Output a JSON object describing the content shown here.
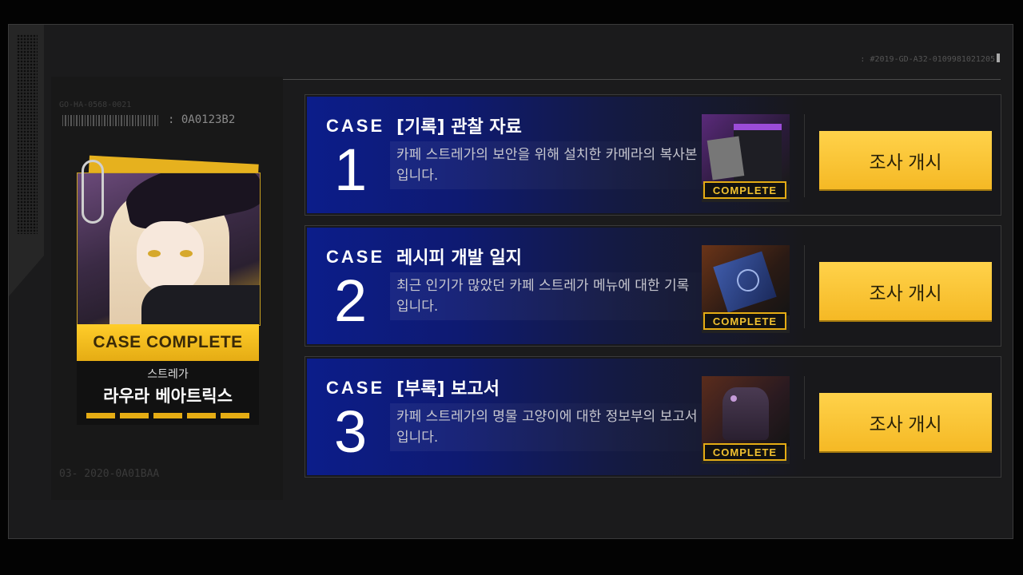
{
  "header": {
    "serial_code": ": #2019-GD-A32-0109981021205"
  },
  "left_panel": {
    "barcode_code": ": 0A0123B2",
    "decor_code_top": "GO-HA-0568-0021",
    "decor_code_bottom": "03- 2020-0A01BAA"
  },
  "character_card": {
    "banner": "CASE COMPLETE",
    "subtitle": "스트레가",
    "name": "라우라 베아트릭스",
    "progress_pips": 5
  },
  "cases": [
    {
      "label": "CASE",
      "number": "1",
      "title": "[기록] 관찰 자료",
      "description": "카페 스트레가의 보안을 위해 설치한 카메라의 복사본입니다.",
      "status": "COMPLETE",
      "button": "조사 개시",
      "thumb_icon": "document-folder-icon"
    },
    {
      "label": "CASE",
      "number": "2",
      "title": "레시피 개발 일지",
      "description": "최근 인기가 많았던 카페 스트레가 메뉴에 대한 기록입니다.",
      "status": "COMPLETE",
      "button": "조사 개시",
      "thumb_icon": "recipe-book-icon"
    },
    {
      "label": "CASE",
      "number": "3",
      "title": "[부록] 보고서",
      "description": "카페 스트레가의 명물 고양이에 대한 정보부의 보고서입니다.",
      "status": "COMPLETE",
      "button": "조사 개시",
      "thumb_icon": "cat-report-icon"
    }
  ],
  "colors": {
    "accent_yellow": "#f5b925",
    "case_blue": "#0c1d8a",
    "background": "#1b1b1c"
  }
}
